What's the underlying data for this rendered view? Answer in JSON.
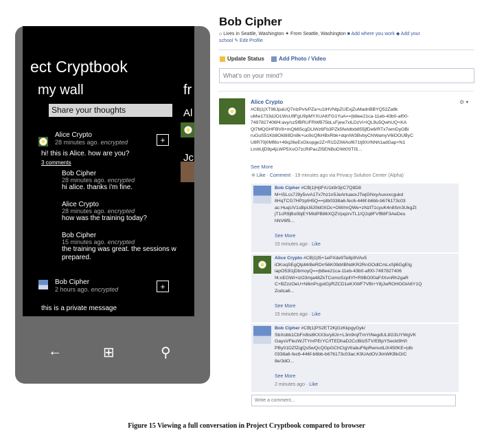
{
  "phone": {
    "title": "ect Cryptbook",
    "pivot_current": "my wall",
    "pivot_next": "fr",
    "side_peek_1": "Al",
    "side_peek_2": "Jc",
    "share_placeholder": "Share your thoughts",
    "posts": [
      {
        "author": "Alice Crypto",
        "meta_time": "28 minutes ago.",
        "meta_tag": "encrypted",
        "message": "hi! this is Alice. how are you?",
        "comments_link": "3 comments",
        "plus": "+",
        "replies": [
          {
            "author": "Bob Cipher",
            "meta_time": "28 minutes ago.",
            "meta_tag": "encrypted",
            "message": "hi alice. thanks i'm fine."
          },
          {
            "author": "Alice Crypto",
            "meta_time": "28 minutes ago.",
            "meta_tag": "encrypted",
            "message": "how was the training today?"
          },
          {
            "author": "Bob Cipher",
            "meta_time": "15 minutes ago.",
            "meta_tag": "encrypted",
            "message": "the training was great. the sessions w",
            "message2": "prepared."
          }
        ]
      },
      {
        "author": "Bob Cipher",
        "meta_time": "2 hours ago.",
        "meta_tag": "encrypted",
        "message": "this is a private message",
        "plus": "+"
      }
    ],
    "nav": {
      "back": "←",
      "start": "⊞",
      "search": "⚲"
    }
  },
  "browser": {
    "profile_name": "Bob Cipher",
    "info_line1": "Lives in Seattle, Washington",
    "info_from": "From Seattle, Washington",
    "info_work": "Add where you work",
    "info_school_a": "Add your",
    "info_school_b": "school",
    "info_edit": "Edit Profile",
    "tab_status": "Update Status",
    "tab_photo": "Add Photo / Video",
    "status_placeholder": "What's on your mind?",
    "post": {
      "author": "Alice Crypto",
      "gear": "⚙ ▾",
      "cipher": "#CB|1|XT98JpaUQ7nlzPvIvPZa+u1tHVNtpZUExjZuMadnBBYQ52Zatlk\nuMw1733dJO1WsUflFgU9pMYXUAKFG1YuA==|b8ee21ca-11eb-43b0-af00-\n7497827406f4:avy/sz5fBRUFRWB75bLsFjew7xlLDzVi+lQL9u5QwhUQ+KA\nQl7MQGHFBV8+mQ665cgDLlWz6Fb3PZk5fwIdtxb855jfDe6/RTx7wmDyOBi\nruGuS51Kb8Ok8I8Dn8k+uo9cQfkHBxRbk+dqnIW3BvbyCNWamyV6lOOUByC\nU8R70j0Mf8o+49q26eExGkopge2Z+R1DZIWAof671tj9X//NNh1adGap+N1\nLmbUjD9p4jLWP5XoO7zcRiPacZl5ENBoDWt0STI5...",
      "see_more": "See More",
      "action_like": "Like",
      "action_comment": "Comment",
      "action_meta": "· 19 minutes ago via Privacy Solution Center (Alpha)",
      "comments": [
        {
          "author": "Bob Cipher",
          "body": " #CB|1|HjtFrU1k9r3jrC7Q8D8\nM+lSLcs7J9y5vvA1Tx7hz1n5JeArtuaoxJTwjGNxyAuxxxcgukd\n8HqTCG7HPzptH5Q==|db0338a6-fec6-446f-b6bb-b676173c03\nac:HuqUV1sBpU8J0kl0XOc+OW/mQWe+zNzf71cyuK4n8Sm3UkgZt\njT1cR9jBo0bjEYMIdPB86XQZVpqzrvTL1/Q2q8FVfB8F3AeDeu\nhNV6f9...",
          "see_more": "See More",
          "time": "15 minutes ago ·",
          "like": "Like"
        },
        {
          "author": "Alice Crypto",
          "body": " #CB|1|t5+1ePXde9Te8p9VAv5\niOKoqSEgQtpMrBeRDrr56K09drlBNdKR2RnGOdlCmLxSjl6GgEIg\niapO53l1jDbmoyQ==|b8ee21ca-11eb-43b0-af00-7497827406\nf4:nEGWI+izO3mja48ZkTComoSzpllYf+R9BO00aF/lXvnRh2gaR\nC+BZzzOeU+N8mPcgotGj/RZCD1eKXWF7VBi+Y8jJwROHOGlA6Y1Q\nZodca6...",
          "see_more": "See More",
          "time": "15 minutes ago ·",
          "like": "Like"
        },
        {
          "author": "Bob Cipher",
          "body": " #CB|1|PS2ET2KjGzKkpgyGyk/\nSbXobb1CbFn8is8KXX3o/y8Jn+L3m9rqfTmYINegdUL8G3UYWgVK\nGaysVFlezWJTYnrPErYC/fTEDhaD2CcBlIz5TV/EBpYSeckt9H/I\nPBy01DZfZqjQs5wQcQGpGChCtgVtIabuF6pRwnvdLlX450KE=|db\n0338a6-fec6-446f-b6bb-b676173c03ac:K9UAdOVJlmWKBkO/C\n8e/3dO...",
          "see_more": "See More",
          "time": "2 minutes ago ·",
          "like": "Like"
        }
      ],
      "write_placeholder": "Write a comment..."
    }
  },
  "caption": "Figure 15 Viewing a full conversation in Project Cryptbook compared to browser"
}
